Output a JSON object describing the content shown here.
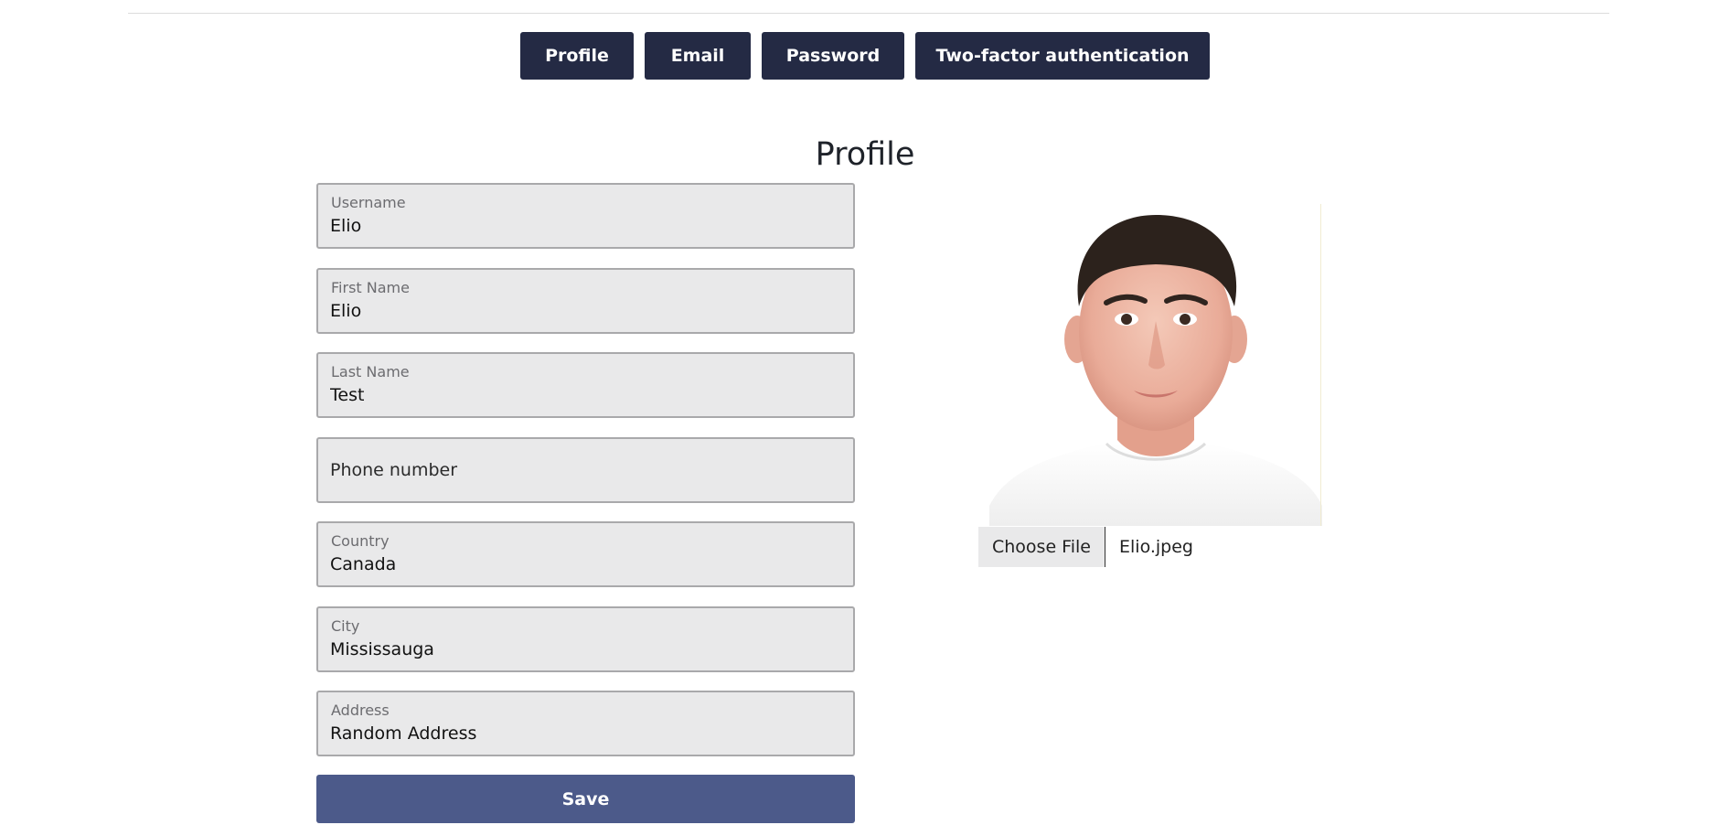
{
  "tabs": [
    {
      "label": "Profile"
    },
    {
      "label": "Email"
    },
    {
      "label": "Password"
    },
    {
      "label": "Two-factor authentication"
    }
  ],
  "page_title": "Profile",
  "fields": {
    "username": {
      "label": "Username",
      "value": "Elio"
    },
    "first_name": {
      "label": "First Name",
      "value": "Elio"
    },
    "last_name": {
      "label": "Last Name",
      "value": "Test"
    },
    "phone": {
      "label": "",
      "value": "",
      "placeholder": "Phone number"
    },
    "country": {
      "label": "Country",
      "value": "Canada"
    },
    "city": {
      "label": "City",
      "value": "Mississauga"
    },
    "address": {
      "label": "Address",
      "value": "Random Address"
    }
  },
  "save_label": "Save",
  "file_input": {
    "button_label": "Choose File",
    "file_name": "Elio.jpeg"
  },
  "colors": {
    "tab_bg": "#242a44",
    "save_bg": "#4c5a8a",
    "field_bg": "#e9e9ea",
    "field_border": "#a9a9ab"
  }
}
